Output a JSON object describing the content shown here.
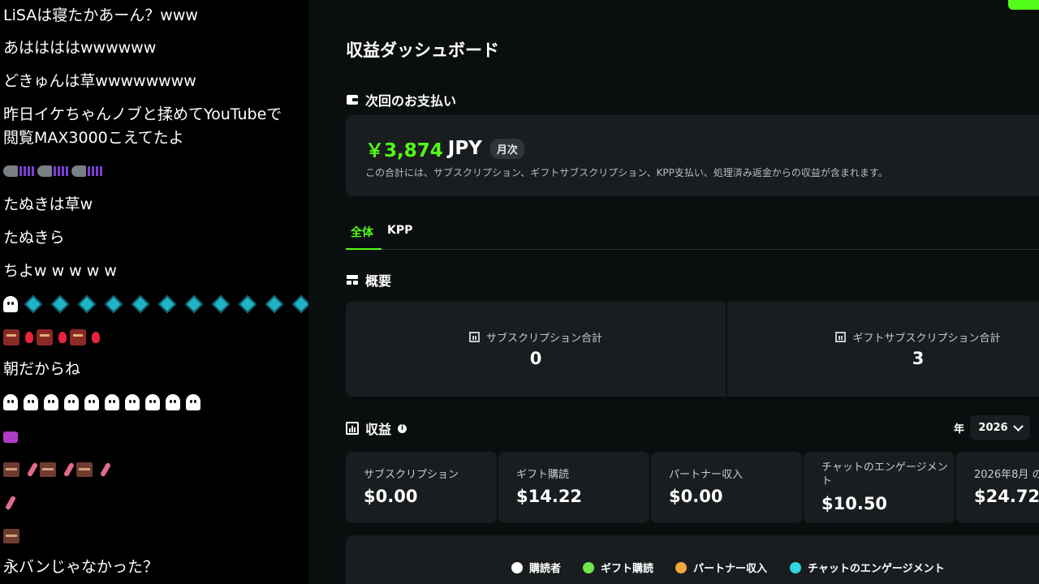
{
  "chat": {
    "messages": [
      "LiSAは寝たかあーん？www",
      "あははははwwwwww",
      "どきゅんは草wwwwwwww",
      "昨日イケちゃんノブと揉めてYouTubeで",
      "閲覧MAX3000こえてたよ",
      "たぬきは草w",
      "たぬきら",
      "ちよw w w w w",
      "朝だからね",
      "永バンじゃなかった？"
    ]
  },
  "dashboard": {
    "title": "収益ダッシュボード",
    "next_payout": {
      "heading": "次回のお支払い",
      "amount": "￥3,874",
      "currency": "JPY",
      "frequency_badge": "月次",
      "description": "この合計には、サブスクリプション、ギフトサブスクリプション、KPP支払い、処理済み返金からの収益が含まれます。"
    },
    "tabs": [
      {
        "label": "全体",
        "active": true
      },
      {
        "label": "KPP",
        "active": false
      }
    ],
    "overview": {
      "heading": "概要",
      "cards": [
        {
          "title": "サブスクリプション合計",
          "value": "0"
        },
        {
          "title": "ギフトサブスクリプション合計",
          "value": "3"
        }
      ]
    },
    "revenue": {
      "heading": "収益",
      "year_label": "年",
      "year_value": "2026",
      "cells": [
        {
          "label": "サブスクリプション",
          "value": "$0.00"
        },
        {
          "label": "ギフト購読",
          "value": "$14.22"
        },
        {
          "label": "パートナー収入",
          "value": "$0.00"
        },
        {
          "label": "チャットのエンゲージメン",
          "label2": "ト",
          "value": "$10.50"
        },
        {
          "label": "2026年8月 の",
          "value": "$24.72"
        }
      ],
      "legend": [
        {
          "label": "購読者",
          "color": "#ffffff"
        },
        {
          "label": "ギフト購読",
          "color": "#6fe64a"
        },
        {
          "label": "パートナー収入",
          "color": "#f2a93b"
        },
        {
          "label": "チャットのエンゲージメント",
          "color": "#2fd6e0"
        }
      ]
    }
  },
  "colors": {
    "accent": "#53fc18",
    "background": "#0b0e0f",
    "card": "#191d1f"
  }
}
